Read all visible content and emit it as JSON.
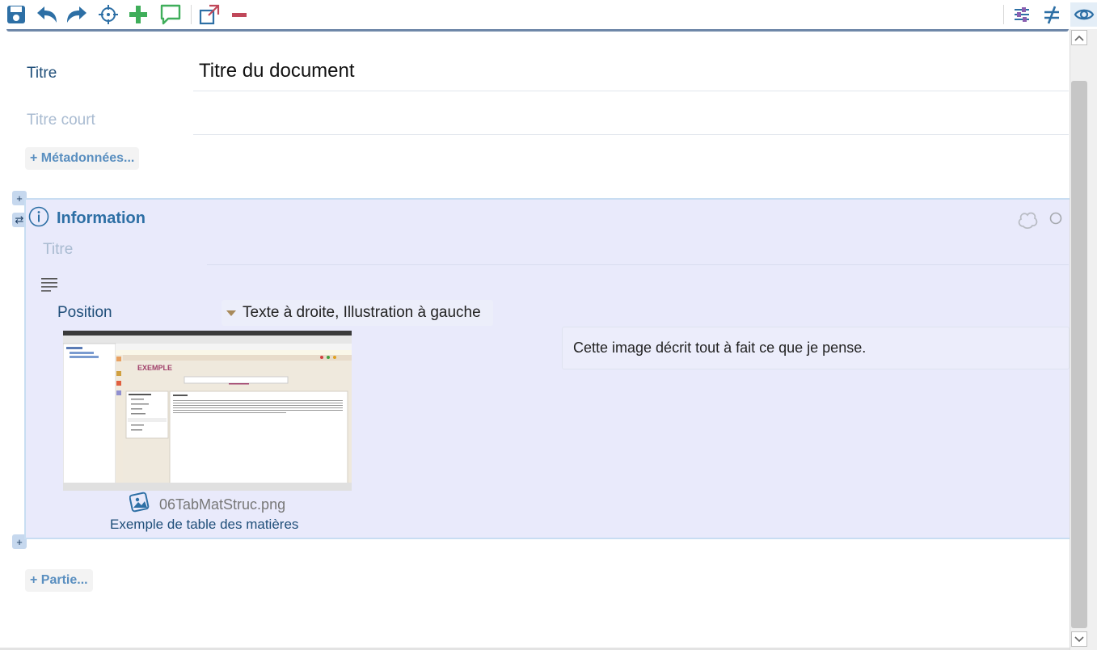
{
  "toolbar": {
    "left_icons": [
      "save-icon",
      "undo-icon",
      "redo-icon",
      "crosshair-icon",
      "add-icon",
      "comment-icon",
      "external-link-icon",
      "remove-icon"
    ],
    "right_icons": [
      "settings-sliders-icon",
      "not-equal-icon",
      "eye-icon"
    ],
    "colors": {
      "primary": "#2d6fa5",
      "add": "#3fae5a",
      "comment": "#3fae5a",
      "remove": "#c0485a",
      "external": "#2d6fa5"
    }
  },
  "document": {
    "title_label": "Titre",
    "title_value": "Titre du document",
    "short_title_label": "Titre court",
    "metadata_button": "+ Métadonnées...",
    "part_button": "+ Partie..."
  },
  "block": {
    "title": "Information",
    "title_field_label": "Titre",
    "position_label": "Position",
    "position_value": "Texte à droite, Illustration à gauche",
    "image_filename": "06TabMatStruc.png",
    "image_legend": "Exemple de table des matières",
    "caption": "Cette image décrit tout à fait ce que je pense.",
    "thumbnail_heading": "EXEMPLE",
    "side_add_label": "+",
    "side_swap_label": "⇄",
    "colors": {
      "background": "#e9eafb",
      "border": "#c8ddf2"
    }
  }
}
